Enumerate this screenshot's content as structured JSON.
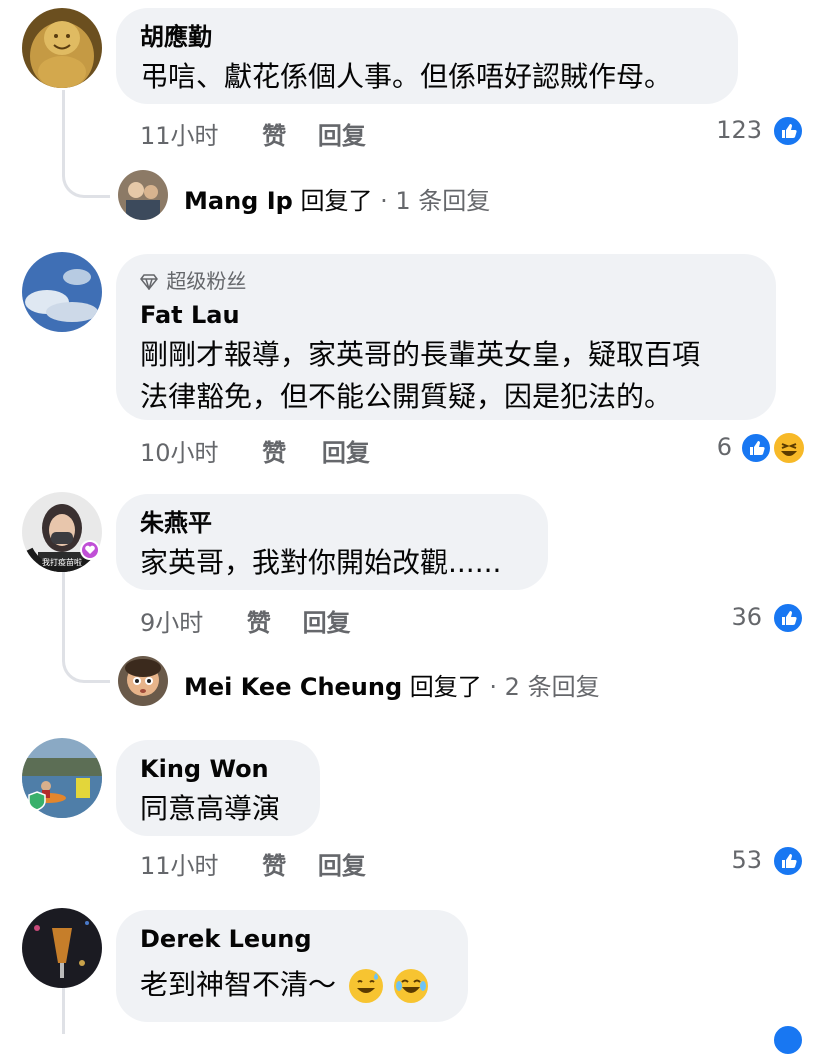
{
  "comments": [
    {
      "author": "胡應勤",
      "text": "弔唁、獻花係個人事。但係唔好認賊作母。",
      "time": "11小时",
      "like_label": "赞",
      "reply_label": "回复",
      "reactions": "123",
      "reply_preview": {
        "author": "Mang Ip",
        "verb": "回复了",
        "count": " · 1 条回复"
      }
    },
    {
      "badge": "超级粉丝",
      "author": "Fat Lau",
      "text_lines": [
        "剛剛才報導，家英哥的長輩英女皇，疑取百項",
        "法律豁免，但不能公開質疑，因是犯法的。"
      ],
      "time": "10小时",
      "like_label": "赞",
      "reply_label": "回复",
      "reactions": "6"
    },
    {
      "author": "朱燕平",
      "text": "家英哥，我對你開始改觀......",
      "time": "9小时",
      "like_label": "赞",
      "reply_label": "回复",
      "reactions": "36",
      "avatar_caption": "我打疫苗啦",
      "reply_preview": {
        "author": "Mei Kee Cheung",
        "verb": "回复了",
        "count": " · 2 条回复"
      }
    },
    {
      "author": "King Won",
      "text": "同意高導演",
      "time": "11小时",
      "like_label": "赞",
      "reply_label": "回复",
      "reactions": "53"
    },
    {
      "author": "Derek Leung",
      "text": "老到神智不清～",
      "emojis": [
        "sweat-smile-emoji",
        "laughing-emoji"
      ]
    }
  ],
  "colors": {
    "bubble": "#f0f2f5",
    "meta": "#65676b",
    "like_blue": "#1877f2",
    "haha_yellow": "#f7b928"
  }
}
